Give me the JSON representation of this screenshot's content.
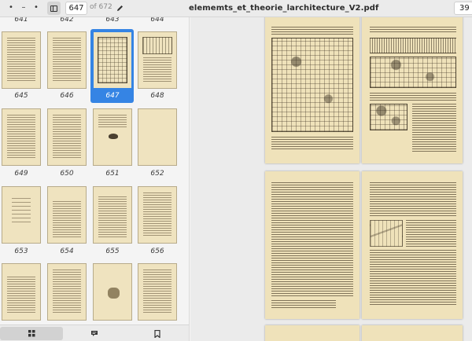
{
  "window": {
    "title": "elememts_et_theorie_larchitecture_V2.pdf",
    "dot1": "•",
    "dot2": "–",
    "dot3": "•"
  },
  "toolbar": {
    "current_page": "647",
    "page_of": "of 672",
    "zoom": "39"
  },
  "sidebar": {
    "header_labels": [
      "641",
      "642",
      "643",
      "644"
    ],
    "rows": [
      {
        "labels": [
          "645",
          "646",
          "647",
          "648"
        ]
      },
      {
        "labels": [
          "649",
          "650",
          "651",
          "652"
        ]
      },
      {
        "labels": [
          "653",
          "654",
          "655",
          "656"
        ]
      }
    ],
    "selected_page": "647"
  },
  "footer": {
    "tabs": [
      "thumbnails-icon",
      "annotations-icon",
      "bookmarks-icon"
    ],
    "active_tab": "thumbnails-icon"
  },
  "colors": {
    "accent": "#3584e4",
    "paper": "#efe2ba"
  }
}
